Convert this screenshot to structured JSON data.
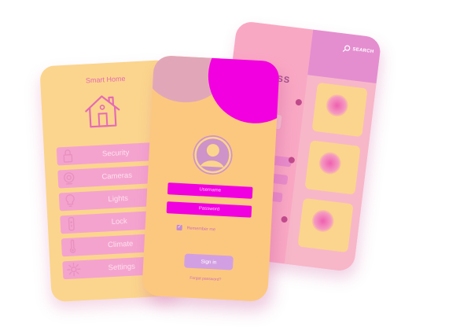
{
  "home_app": {
    "title": "Smart Home",
    "menu": [
      {
        "label": "Security",
        "icon": "lock-icon"
      },
      {
        "label": "Cameras",
        "icon": "camera-icon"
      },
      {
        "label": "Lights",
        "icon": "lightbulb-icon"
      },
      {
        "label": "Lock",
        "icon": "door-lock-icon"
      },
      {
        "label": "Climate",
        "icon": "thermometer-icon"
      },
      {
        "label": "Settings",
        "icon": "gear-icon"
      }
    ]
  },
  "login_app": {
    "username_placeholder": "Username",
    "password_placeholder": "Password",
    "remember_label": "Remember me",
    "sign_in_label": "Sign in",
    "forgot_label": "Forgot password?"
  },
  "back_app": {
    "search_label": "SEARCH",
    "title": "NESS"
  },
  "colors": {
    "peach": "#fbd58d",
    "pink": "#f4a3cf",
    "magenta": "#f000e0",
    "lavender": "#d2a0e2"
  }
}
